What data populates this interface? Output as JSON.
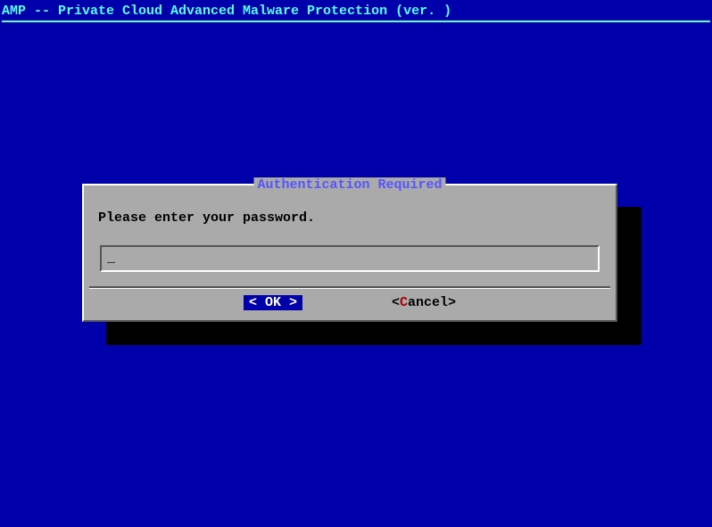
{
  "header": {
    "title": "AMP -- Private Cloud Advanced Malware Protection (ver. )"
  },
  "dialog": {
    "title": "Authentication Required",
    "prompt": "Please enter your password.",
    "input_value": "",
    "cursor": "_"
  },
  "buttons": {
    "ok": {
      "open": "<",
      "label": " OK ",
      "close": ">"
    },
    "cancel": {
      "open": "<",
      "hot": "C",
      "rest": "ancel",
      "close": ">"
    }
  }
}
